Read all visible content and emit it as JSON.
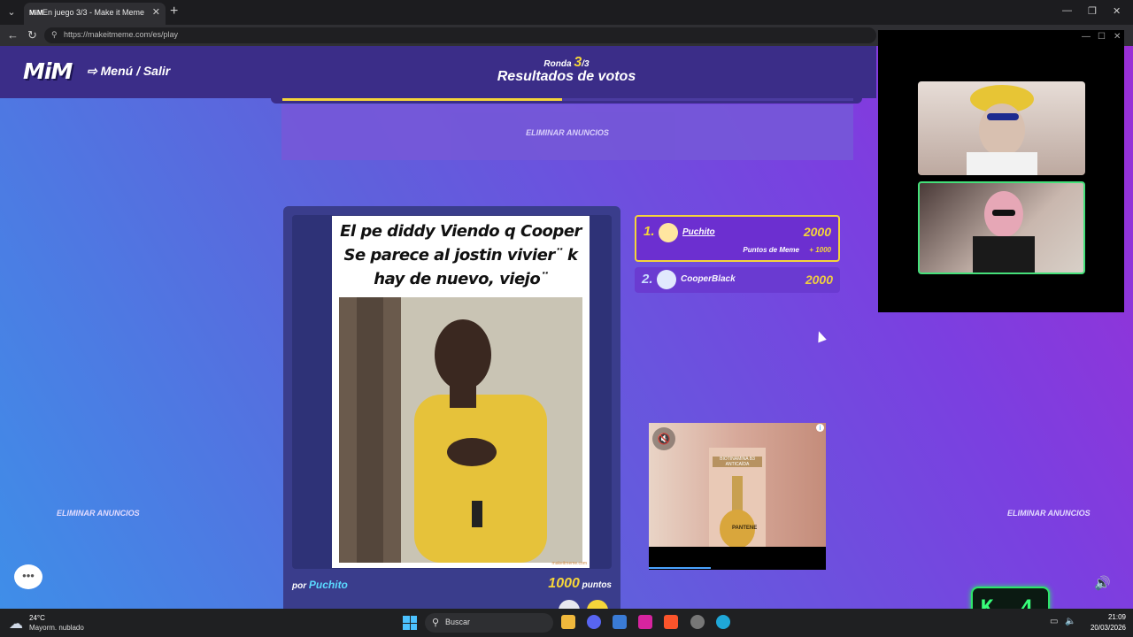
{
  "browser": {
    "tab_title": "En juego 3/3 - Make it Meme",
    "tab_favicon": "MiM",
    "url": "https://makeitmeme.com/es/play"
  },
  "header": {
    "logo": "MiM",
    "menu_link": "Menú / Salir",
    "round_label": "Ronda",
    "round_current": "3",
    "round_total": "/3",
    "title": "Resultados de votos",
    "progress": 0.49
  },
  "ads": {
    "remove_label": "ELIMINAR ANUNCIOS"
  },
  "meme": {
    "caption": "El pe diddy Viendo q Cooper Se parece al jostin vivier¨ k hay de nuevo, viejo¨",
    "watermark": "makeitmeme.com",
    "by_label": "por",
    "author": "Puchito",
    "points": "1000",
    "points_label": "puntos"
  },
  "leaderboard": [
    {
      "rank": "1.",
      "name": "Puchito",
      "score": "2000",
      "meme_label": "Puntos de Meme",
      "meme_bonus": "+ 1000"
    },
    {
      "rank": "2.",
      "name": "CooperBlack",
      "score": "2000"
    }
  ],
  "video_ad": {
    "bottle_label": "BIOTINAMINA B3 ANTICAÍDA",
    "brand": "PANTENE",
    "progress": 0.35
  },
  "overlay": {
    "k_badge": "K 4"
  },
  "taskbar": {
    "weather_temp": "24°C",
    "weather_desc": "Mayorm. nublado",
    "search_placeholder": "Buscar",
    "time": "21:09",
    "date": "20/03/2026"
  },
  "colors": {
    "accent_yellow": "#f5d53a",
    "header_purple": "#3b2d88",
    "author_cyan": "#5ad9ff",
    "cam_border_green": "#45e07a"
  }
}
